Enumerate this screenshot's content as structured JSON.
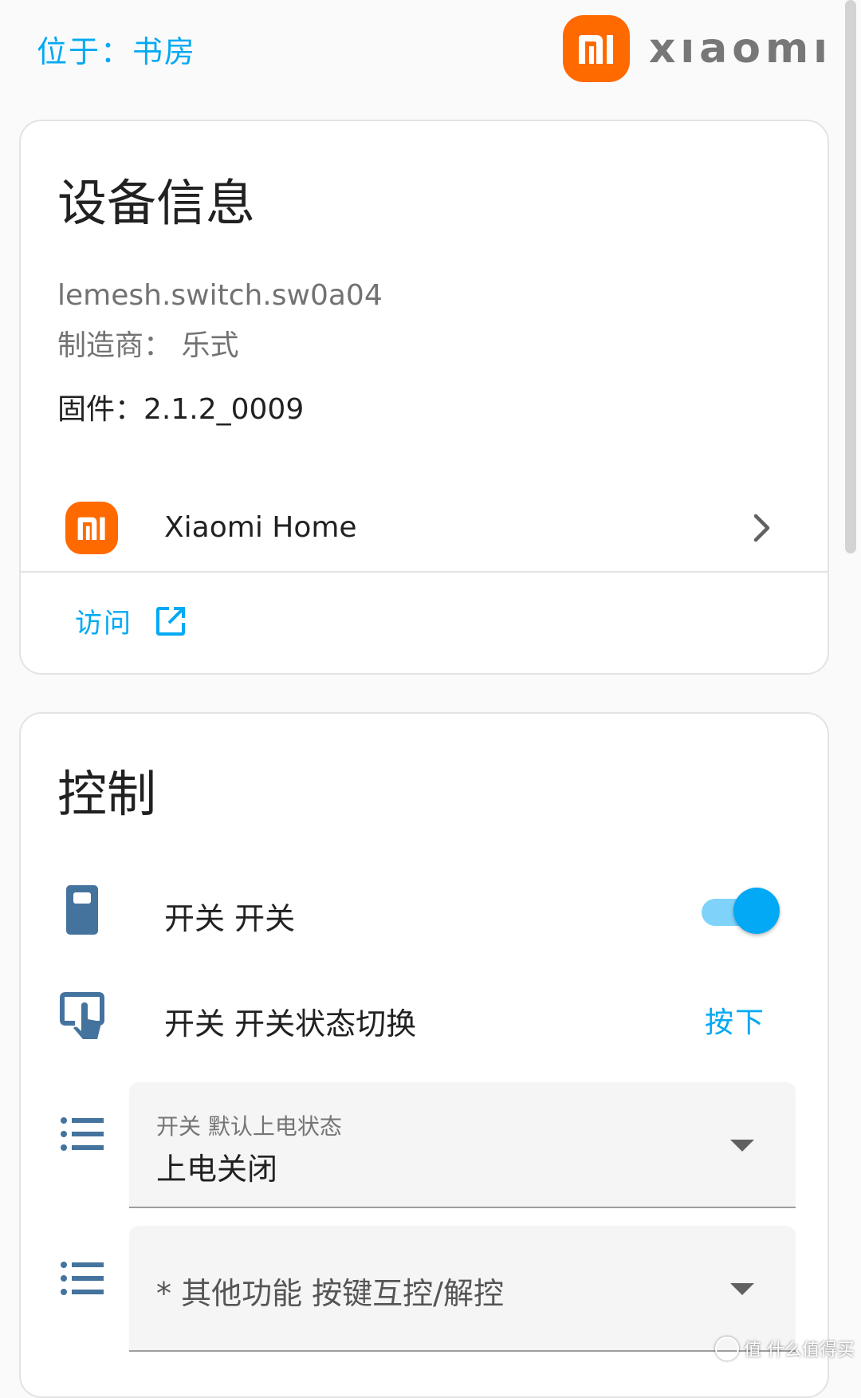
{
  "header": {
    "location": "位于：书房",
    "brand_name": "xıaomı",
    "brand_color": "#ff6a00"
  },
  "device_info": {
    "title": "设备信息",
    "model": "lemesh.switch.sw0a04",
    "manufacturer": "制造商：  乐式",
    "firmware": "固件：2.1.2_0009",
    "integration": {
      "name": "Xiaomi Home",
      "logo_icon": "mi-logo-icon",
      "chevron_icon": "chevron-right-icon"
    },
    "visit_label": "访问",
    "visit_icon": "open-in-new-icon"
  },
  "controls": {
    "title": "控制",
    "switch": {
      "label": "开关 开关",
      "icon": "light-switch-icon",
      "state": "on"
    },
    "toggle_action": {
      "label": "开关 开关状态切换",
      "icon": "gesture-tap-button-icon",
      "button_label": "按下"
    },
    "power_on_state": {
      "icon": "format-list-bulleted-icon",
      "label": "开关 默认上电状态",
      "value": "上电关闭"
    },
    "interlock": {
      "icon": "format-list-bulleted-icon",
      "placeholder": "* 其他功能 按键互控/解控"
    }
  },
  "accent_color": "#03a9f4",
  "watermark": "值 什么值得买"
}
